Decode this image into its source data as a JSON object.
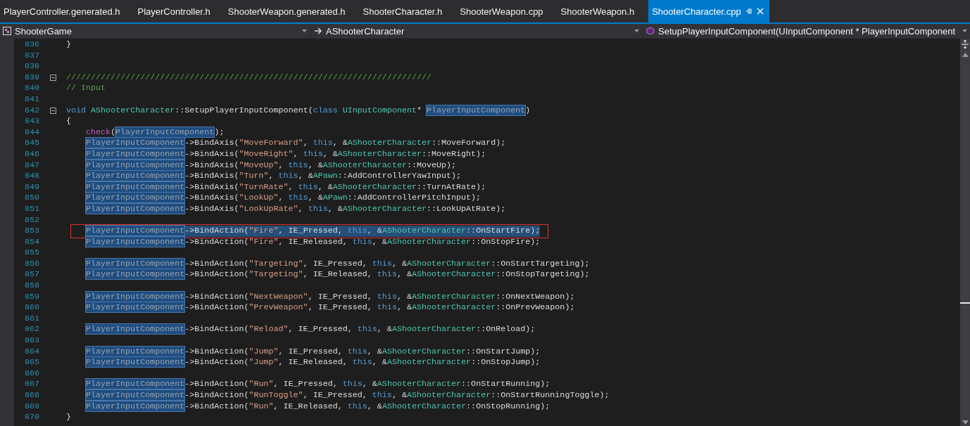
{
  "tabs": [
    {
      "label": "PlayerController.generated.h",
      "selected": false
    },
    {
      "label": "PlayerController.h",
      "selected": false
    },
    {
      "label": "ShooterWeapon.generated.h",
      "selected": false
    },
    {
      "label": "ShooterCharacter.h",
      "selected": false
    },
    {
      "label": "ShooterWeapon.cpp",
      "selected": false
    },
    {
      "label": "ShooterWeapon.h",
      "selected": false
    },
    {
      "label": "ShooterCharacter.cpp",
      "selected": true
    }
  ],
  "navigation": [
    {
      "kind": "project",
      "text": "ShooterGame"
    },
    {
      "kind": "class",
      "text": "AShooterCharacter"
    },
    {
      "kind": "method",
      "text": "SetupPlayerInputComponent(UInputComponent * PlayerInputComponent"
    }
  ],
  "lines": [
    {
      "number": "836",
      "code": [
        {
          "kind": "plain",
          "text": "}"
        }
      ]
    },
    {
      "number": "837"
    },
    {
      "number": "838"
    },
    {
      "number": "839",
      "expanded": true,
      "code": [
        {
          "kind": "comment",
          "text": "//////////////////////////////////////////////////////////////////////////"
        }
      ]
    },
    {
      "number": "840",
      "code": [
        {
          "kind": "comment",
          "text": "// Input"
        }
      ]
    },
    {
      "number": "841"
    },
    {
      "number": "842",
      "expanded": true,
      "code": [
        {
          "kind": "keyword",
          "text": "void "
        },
        {
          "kind": "type",
          "text": "AShooterCharacter"
        },
        {
          "kind": "plain",
          "text": "::SetupPlayerInputComponent("
        },
        {
          "kind": "keyword",
          "text": "class "
        },
        {
          "kind": "type",
          "text": "UInputComponent"
        },
        {
          "kind": "plain",
          "text": "* "
        },
        {
          "kind": "reference",
          "text": "PlayerInputComponent"
        },
        {
          "kind": "plain",
          "text": ")"
        }
      ]
    },
    {
      "number": "843",
      "code": [
        {
          "kind": "plain",
          "text": "{"
        }
      ]
    },
    {
      "number": "844",
      "indented": true,
      "code": [
        {
          "kind": "macro",
          "text": "check"
        },
        {
          "kind": "plain",
          "text": "("
        },
        {
          "kind": "reference",
          "text": "PlayerInputComponent"
        },
        {
          "kind": "plain",
          "text": ");"
        }
      ]
    },
    {
      "number": "845",
      "indented": true,
      "code": [
        {
          "kind": "reference",
          "text": "PlayerInputComponent"
        },
        {
          "kind": "plain",
          "text": "->BindAxis("
        },
        {
          "kind": "string",
          "text": "\"MoveForward\""
        },
        {
          "kind": "plain",
          "text": ", "
        },
        {
          "kind": "keyword",
          "text": "this"
        },
        {
          "kind": "plain",
          "text": ", &"
        },
        {
          "kind": "type",
          "text": "AShooterCharacter"
        },
        {
          "kind": "plain",
          "text": "::MoveForward);"
        }
      ]
    },
    {
      "number": "846",
      "indented": true,
      "code": [
        {
          "kind": "reference",
          "text": "PlayerInputComponent"
        },
        {
          "kind": "plain",
          "text": "->BindAxis("
        },
        {
          "kind": "string",
          "text": "\"MoveRight\""
        },
        {
          "kind": "plain",
          "text": ", "
        },
        {
          "kind": "keyword",
          "text": "this"
        },
        {
          "kind": "plain",
          "text": ", &"
        },
        {
          "kind": "type",
          "text": "AShooterCharacter"
        },
        {
          "kind": "plain",
          "text": "::MoveRight);"
        }
      ]
    },
    {
      "number": "847",
      "indented": true,
      "code": [
        {
          "kind": "reference",
          "text": "PlayerInputComponent"
        },
        {
          "kind": "plain",
          "text": "->BindAxis("
        },
        {
          "kind": "string",
          "text": "\"MoveUp\""
        },
        {
          "kind": "plain",
          "text": ", "
        },
        {
          "kind": "keyword",
          "text": "this"
        },
        {
          "kind": "plain",
          "text": ", &"
        },
        {
          "kind": "type",
          "text": "AShooterCharacter"
        },
        {
          "kind": "plain",
          "text": "::MoveUp);"
        }
      ]
    },
    {
      "number": "848",
      "indented": true,
      "code": [
        {
          "kind": "reference",
          "text": "PlayerInputComponent"
        },
        {
          "kind": "plain",
          "text": "->BindAxis("
        },
        {
          "kind": "string",
          "text": "\"Turn\""
        },
        {
          "kind": "plain",
          "text": ", "
        },
        {
          "kind": "keyword",
          "text": "this"
        },
        {
          "kind": "plain",
          "text": ", &"
        },
        {
          "kind": "type",
          "text": "APawn"
        },
        {
          "kind": "plain",
          "text": "::AddControllerYawInput);"
        }
      ]
    },
    {
      "number": "849",
      "indented": true,
      "code": [
        {
          "kind": "reference",
          "text": "PlayerInputComponent"
        },
        {
          "kind": "plain",
          "text": "->BindAxis("
        },
        {
          "kind": "string",
          "text": "\"TurnRate\""
        },
        {
          "kind": "plain",
          "text": ", "
        },
        {
          "kind": "keyword",
          "text": "this"
        },
        {
          "kind": "plain",
          "text": ", &"
        },
        {
          "kind": "type",
          "text": "AShooterCharacter"
        },
        {
          "kind": "plain",
          "text": "::TurnAtRate);"
        }
      ]
    },
    {
      "number": "850",
      "indented": true,
      "code": [
        {
          "kind": "reference",
          "text": "PlayerInputComponent"
        },
        {
          "kind": "plain",
          "text": "->BindAxis("
        },
        {
          "kind": "string",
          "text": "\"LookUp\""
        },
        {
          "kind": "plain",
          "text": ", "
        },
        {
          "kind": "keyword",
          "text": "this"
        },
        {
          "kind": "plain",
          "text": ", &"
        },
        {
          "kind": "type",
          "text": "APawn"
        },
        {
          "kind": "plain",
          "text": "::AddControllerPitchInput);"
        }
      ]
    },
    {
      "number": "851",
      "indented": true,
      "code": [
        {
          "kind": "reference",
          "text": "PlayerInputComponent"
        },
        {
          "kind": "plain",
          "text": "->BindAxis("
        },
        {
          "kind": "string",
          "text": "\"LookUpRate\""
        },
        {
          "kind": "plain",
          "text": ", "
        },
        {
          "kind": "keyword",
          "text": "this"
        },
        {
          "kind": "plain",
          "text": ", &"
        },
        {
          "kind": "type",
          "text": "AShooterCharacter"
        },
        {
          "kind": "plain",
          "text": "::LookUpAtRate);"
        }
      ]
    },
    {
      "number": "852"
    },
    {
      "number": "853",
      "indented": true,
      "selected": true,
      "annotated": true,
      "code": [
        {
          "kind": "reference",
          "text": "PlayerInputComponent"
        },
        {
          "kind": "plain",
          "text": "->BindAction("
        },
        {
          "kind": "string",
          "text": "\"Fire\""
        },
        {
          "kind": "plain",
          "text": ", IE_Pressed, "
        },
        {
          "kind": "keyword",
          "text": "this"
        },
        {
          "kind": "plain",
          "text": ", &"
        },
        {
          "kind": "type",
          "text": "AShooterCharacter"
        },
        {
          "kind": "plain",
          "text": "::OnStartFire);"
        }
      ]
    },
    {
      "number": "854",
      "indented": true,
      "code": [
        {
          "kind": "reference",
          "text": "PlayerInputComponent"
        },
        {
          "kind": "plain",
          "text": "->BindAction("
        },
        {
          "kind": "string",
          "text": "\"Fire\""
        },
        {
          "kind": "plain",
          "text": ", IE_Released, "
        },
        {
          "kind": "keyword",
          "text": "this"
        },
        {
          "kind": "plain",
          "text": ", &"
        },
        {
          "kind": "type",
          "text": "AShooterCharacter"
        },
        {
          "kind": "plain",
          "text": "::OnStopFire);"
        }
      ]
    },
    {
      "number": "855"
    },
    {
      "number": "856",
      "indented": true,
      "code": [
        {
          "kind": "reference",
          "text": "PlayerInputComponent"
        },
        {
          "kind": "plain",
          "text": "->BindAction("
        },
        {
          "kind": "string",
          "text": "\"Targeting\""
        },
        {
          "kind": "plain",
          "text": ", IE_Pressed, "
        },
        {
          "kind": "keyword",
          "text": "this"
        },
        {
          "kind": "plain",
          "text": ", &"
        },
        {
          "kind": "type",
          "text": "AShooterCharacter"
        },
        {
          "kind": "plain",
          "text": "::OnStartTargeting);"
        }
      ]
    },
    {
      "number": "857",
      "indented": true,
      "code": [
        {
          "kind": "reference",
          "text": "PlayerInputComponent"
        },
        {
          "kind": "plain",
          "text": "->BindAction("
        },
        {
          "kind": "string",
          "text": "\"Targeting\""
        },
        {
          "kind": "plain",
          "text": ", IE_Released, "
        },
        {
          "kind": "keyword",
          "text": "this"
        },
        {
          "kind": "plain",
          "text": ", &"
        },
        {
          "kind": "type",
          "text": "AShooterCharacter"
        },
        {
          "kind": "plain",
          "text": "::OnStopTargeting);"
        }
      ]
    },
    {
      "number": "858"
    },
    {
      "number": "859",
      "indented": true,
      "code": [
        {
          "kind": "reference",
          "text": "PlayerInputComponent"
        },
        {
          "kind": "plain",
          "text": "->BindAction("
        },
        {
          "kind": "string",
          "text": "\"NextWeapon\""
        },
        {
          "kind": "plain",
          "text": ", IE_Pressed, "
        },
        {
          "kind": "keyword",
          "text": "this"
        },
        {
          "kind": "plain",
          "text": ", &"
        },
        {
          "kind": "type",
          "text": "AShooterCharacter"
        },
        {
          "kind": "plain",
          "text": "::OnNextWeapon);"
        }
      ]
    },
    {
      "number": "860",
      "indented": true,
      "code": [
        {
          "kind": "reference",
          "text": "PlayerInputComponent"
        },
        {
          "kind": "plain",
          "text": "->BindAction("
        },
        {
          "kind": "string",
          "text": "\"PrevWeapon\""
        },
        {
          "kind": "plain",
          "text": ", IE_Pressed, "
        },
        {
          "kind": "keyword",
          "text": "this"
        },
        {
          "kind": "plain",
          "text": ", &"
        },
        {
          "kind": "type",
          "text": "AShooterCharacter"
        },
        {
          "kind": "plain",
          "text": "::OnPrevWeapon);"
        }
      ]
    },
    {
      "number": "861"
    },
    {
      "number": "862",
      "indented": true,
      "code": [
        {
          "kind": "reference",
          "text": "PlayerInputComponent"
        },
        {
          "kind": "plain",
          "text": "->BindAction("
        },
        {
          "kind": "string",
          "text": "\"Reload\""
        },
        {
          "kind": "plain",
          "text": ", IE_Pressed, "
        },
        {
          "kind": "keyword",
          "text": "this"
        },
        {
          "kind": "plain",
          "text": ", &"
        },
        {
          "kind": "type",
          "text": "AShooterCharacter"
        },
        {
          "kind": "plain",
          "text": "::OnReload);"
        }
      ]
    },
    {
      "number": "863"
    },
    {
      "number": "864",
      "indented": true,
      "code": [
        {
          "kind": "reference",
          "text": "PlayerInputComponent"
        },
        {
          "kind": "plain",
          "text": "->BindAction("
        },
        {
          "kind": "string",
          "text": "\"Jump\""
        },
        {
          "kind": "plain",
          "text": ", IE_Pressed, "
        },
        {
          "kind": "keyword",
          "text": "this"
        },
        {
          "kind": "plain",
          "text": ", &"
        },
        {
          "kind": "type",
          "text": "AShooterCharacter"
        },
        {
          "kind": "plain",
          "text": "::OnStartJump);"
        }
      ]
    },
    {
      "number": "865",
      "indented": true,
      "code": [
        {
          "kind": "reference",
          "text": "PlayerInputComponent"
        },
        {
          "kind": "plain",
          "text": "->BindAction("
        },
        {
          "kind": "string",
          "text": "\"Jump\""
        },
        {
          "kind": "plain",
          "text": ", IE_Released, "
        },
        {
          "kind": "keyword",
          "text": "this"
        },
        {
          "kind": "plain",
          "text": ", &"
        },
        {
          "kind": "type",
          "text": "AShooterCharacter"
        },
        {
          "kind": "plain",
          "text": "::OnStopJump);"
        }
      ]
    },
    {
      "number": "866"
    },
    {
      "number": "867",
      "indented": true,
      "code": [
        {
          "kind": "reference",
          "text": "PlayerInputComponent"
        },
        {
          "kind": "plain",
          "text": "->BindAction("
        },
        {
          "kind": "string",
          "text": "\"Run\""
        },
        {
          "kind": "plain",
          "text": ", IE_Pressed, "
        },
        {
          "kind": "keyword",
          "text": "this"
        },
        {
          "kind": "plain",
          "text": ", &"
        },
        {
          "kind": "type",
          "text": "AShooterCharacter"
        },
        {
          "kind": "plain",
          "text": "::OnStartRunning);"
        }
      ]
    },
    {
      "number": "868",
      "indented": true,
      "code": [
        {
          "kind": "reference",
          "text": "PlayerInputComponent"
        },
        {
          "kind": "plain",
          "text": "->BindAction("
        },
        {
          "kind": "string",
          "text": "\"RunToggle\""
        },
        {
          "kind": "plain",
          "text": ", IE_Pressed, "
        },
        {
          "kind": "keyword",
          "text": "this"
        },
        {
          "kind": "plain",
          "text": ", &"
        },
        {
          "kind": "type",
          "text": "AShooterCharacter"
        },
        {
          "kind": "plain",
          "text": "::OnStartRunningToggle);"
        }
      ]
    },
    {
      "number": "869",
      "indented": true,
      "code": [
        {
          "kind": "reference",
          "text": "PlayerInputComponent"
        },
        {
          "kind": "plain",
          "text": "->BindAction("
        },
        {
          "kind": "string",
          "text": "\"Run\""
        },
        {
          "kind": "plain",
          "text": ", IE_Released, "
        },
        {
          "kind": "keyword",
          "text": "this"
        },
        {
          "kind": "plain",
          "text": ", &"
        },
        {
          "kind": "type",
          "text": "AShooterCharacter"
        },
        {
          "kind": "plain",
          "text": "::OnStopRunning);"
        }
      ]
    },
    {
      "number": "870",
      "code": [
        {
          "kind": "plain",
          "text": "}"
        }
      ]
    }
  ]
}
